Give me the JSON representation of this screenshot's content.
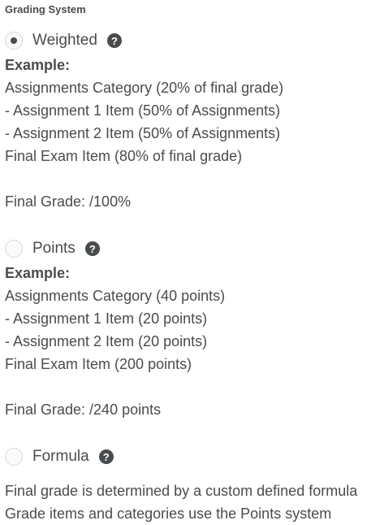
{
  "heading": "Grading System",
  "help_glyph": "?",
  "options": [
    {
      "label": "Weighted",
      "checked": true,
      "example_label": "Example:",
      "lines": [
        "Assignments Category (20% of final grade)",
        "- Assignment 1 Item (50% of Assignments)",
        "- Assignment 2 Item (50% of Assignments)",
        "Final Exam Item (80% of final grade)"
      ],
      "final_grade": "Final Grade: /100%"
    },
    {
      "label": "Points",
      "checked": false,
      "example_label": "Example:",
      "lines": [
        "Assignments Category (40 points)",
        "- Assignment 1 Item (20 points)",
        "- Assignment 2 Item (20 points)",
        "Final Exam Item (200 points)"
      ],
      "final_grade": "Final Grade: /240 points"
    },
    {
      "label": "Formula",
      "checked": false,
      "lines": [
        "Final grade is determined by a custom defined formula",
        "Grade items and categories use the Points system"
      ]
    }
  ],
  "icons": {
    "help": "question-circle-icon"
  },
  "colors": {
    "text": "#494c4e",
    "radio_border": "#d3d9e3"
  }
}
